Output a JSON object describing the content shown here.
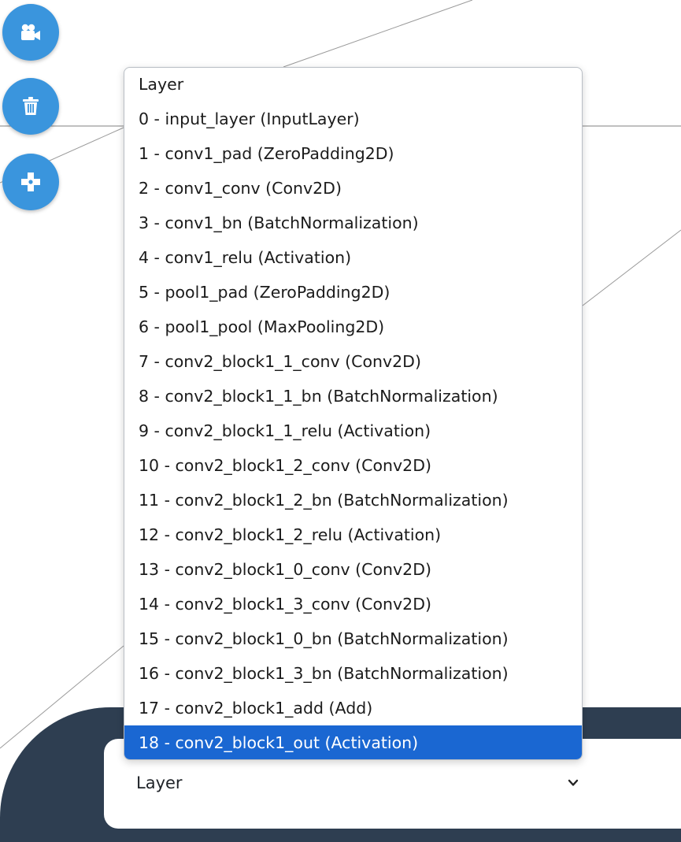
{
  "sidebar": {
    "buttons": [
      {
        "icon": "video-camera-icon",
        "name": "camera"
      },
      {
        "icon": "trash-icon",
        "name": "trash"
      },
      {
        "icon": "gamepad-icon",
        "name": "gamepad"
      }
    ],
    "button_color": "#3a95dd"
  },
  "layer_select": {
    "value": "Layer",
    "chevron_icon": "chevron-down-icon"
  },
  "dropdown": {
    "header": "Layer",
    "selected_index": 18,
    "selected_color": "#1a67d2",
    "options": [
      "0 - input_layer (InputLayer)",
      "1 - conv1_pad (ZeroPadding2D)",
      "2 - conv1_conv (Conv2D)",
      "3 - conv1_bn (BatchNormalization)",
      "4 - conv1_relu (Activation)",
      "5 - pool1_pad (ZeroPadding2D)",
      "6 - pool1_pool (MaxPooling2D)",
      "7 - conv2_block1_1_conv (Conv2D)",
      "8 - conv2_block1_1_bn (BatchNormalization)",
      "9 - conv2_block1_1_relu (Activation)",
      "10 - conv2_block1_2_conv (Conv2D)",
      "11 - conv2_block1_2_bn (BatchNormalization)",
      "12 - conv2_block1_2_relu (Activation)",
      "13 - conv2_block1_0_conv (Conv2D)",
      "14 - conv2_block1_3_conv (Conv2D)",
      "15 - conv2_block1_0_bn (BatchNormalization)",
      "16 - conv2_block1_3_bn (BatchNormalization)",
      "17 - conv2_block1_add (Add)",
      "18 - conv2_block1_out (Activation)"
    ]
  },
  "panel_color": "#2e3e51"
}
